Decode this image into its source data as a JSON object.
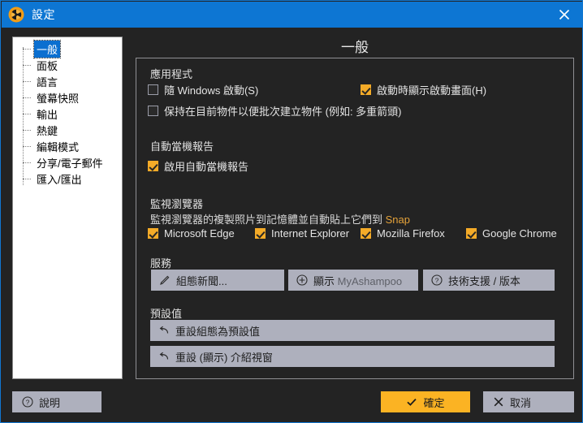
{
  "window": {
    "title": "設定",
    "icon": "aperture-icon",
    "close_label": "×",
    "accent_blue": "#0d76d3",
    "accent_amber": "#fbb323",
    "background": "#232323"
  },
  "sidebar": {
    "items": [
      {
        "label": "一般",
        "selected": true
      },
      {
        "label": "面板",
        "selected": false
      },
      {
        "label": "語言",
        "selected": false
      },
      {
        "label": "螢幕快照",
        "selected": false
      },
      {
        "label": "輸出",
        "selected": false
      },
      {
        "label": "熱鍵",
        "selected": false
      },
      {
        "label": "編輯模式",
        "selected": false
      },
      {
        "label": "分享/電子郵件",
        "selected": false
      },
      {
        "label": "匯入/匯出",
        "selected": false
      }
    ]
  },
  "page": {
    "title": "一般",
    "sections": {
      "application": {
        "label": "應用程式",
        "checkboxes": [
          {
            "text": "隨 Windows 啟動(S)",
            "checked": false
          },
          {
            "text": "啟動時顯示啟動畫面(H)",
            "checked": true
          },
          {
            "text": "保持在目前物件以便批次建立物件 (例如: 多重箭頭)",
            "checked": false
          }
        ]
      },
      "crash_report": {
        "label": "自動當機報告",
        "checkboxes": [
          {
            "text": "啟用自動當機報告",
            "checked": true
          }
        ]
      },
      "browser_monitor": {
        "label": "監視瀏覽器",
        "description": "監視瀏覽器的複製照片到記憶體並自動貼上它們到 ",
        "description_accent": "Snap",
        "checkboxes": [
          {
            "text": "Microsoft Edge",
            "checked": true
          },
          {
            "text": "Internet Explorer",
            "checked": true
          },
          {
            "text": "Mozilla Firefox",
            "checked": true
          },
          {
            "text": "Google Chrome",
            "checked": true
          }
        ]
      },
      "services": {
        "label": "服務",
        "buttons": [
          {
            "label": "組態新聞...",
            "icon": "pen-icon"
          },
          {
            "label": "顯示 ",
            "label_gray": "MyAshampoo",
            "icon": "plus-circle-icon"
          },
          {
            "label": "技術支援 / 版本",
            "icon": "question-circle-icon"
          }
        ]
      },
      "defaults": {
        "label": "預設值",
        "buttons": [
          {
            "label": "重設組態為預設值",
            "icon": "undo-icon"
          },
          {
            "label": "重設 (顯示) 介紹視窗",
            "icon": "undo-icon"
          }
        ]
      }
    }
  },
  "footer": {
    "help": {
      "label": "說明",
      "icon": "question-circle-icon"
    },
    "ok": {
      "label": "確定",
      "icon": "check-icon"
    },
    "cancel": {
      "label": "取消",
      "icon": "x-icon"
    }
  }
}
